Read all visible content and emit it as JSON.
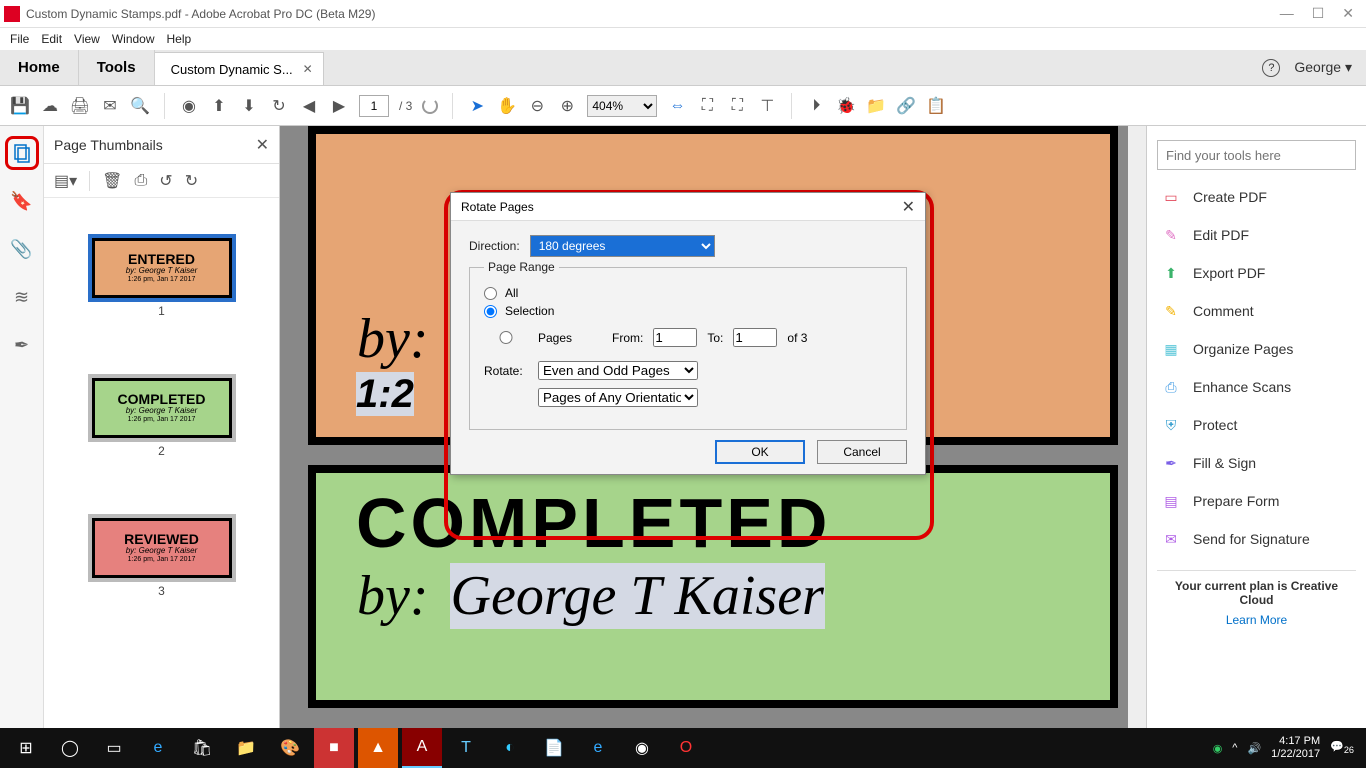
{
  "titlebar": {
    "title": "Custom Dynamic Stamps.pdf - Adobe Acrobat Pro DC (Beta M29)"
  },
  "menubar": {
    "items": [
      "File",
      "Edit",
      "View",
      "Window",
      "Help"
    ]
  },
  "tabs": {
    "home": "Home",
    "tools": "Tools",
    "doc": "Custom Dynamic S...",
    "user": "George"
  },
  "toolbar": {
    "page": "1",
    "pages_of": "/ 3",
    "zoom": "404%"
  },
  "thumbs": {
    "title": "Page Thumbnails",
    "items": [
      {
        "label": "ENTERED",
        "by": "by: George T Kaiser",
        "ts": "1:26 pm, Jan 17 2017",
        "bg": "#e6a574",
        "num": "1",
        "sel": true
      },
      {
        "label": "COMPLETED",
        "by": "by: George T Kaiser",
        "ts": "1:26 pm, Jan 17 2017",
        "bg": "#a6d48b",
        "num": "2",
        "sel": false
      },
      {
        "label": "REVIEWED",
        "by": "by: George T Kaiser",
        "ts": "1:26 pm, Jan 17 2017",
        "bg": "#e6817e",
        "num": "3",
        "sel": false
      }
    ]
  },
  "doc": {
    "page1": {
      "by": "by:",
      "ts_prefix": "1:2"
    },
    "page2": {
      "title": "COMPLETED",
      "by": "by:",
      "name": "George T Kaiser"
    }
  },
  "rightpanel": {
    "search_ph": "Find your tools here",
    "tools": [
      {
        "label": "Create PDF",
        "color": "#e2495b",
        "glyph": "▭"
      },
      {
        "label": "Edit PDF",
        "color": "#e071c4",
        "glyph": "✎"
      },
      {
        "label": "Export PDF",
        "color": "#3bb36b",
        "glyph": "⬆"
      },
      {
        "label": "Comment",
        "color": "#f2b200",
        "glyph": "✎"
      },
      {
        "label": "Organize Pages",
        "color": "#5bc7d9",
        "glyph": "▦"
      },
      {
        "label": "Enhance Scans",
        "color": "#4aa0e6",
        "glyph": "⎙"
      },
      {
        "label": "Protect",
        "color": "#3aa0d0",
        "glyph": "⛨"
      },
      {
        "label": "Fill & Sign",
        "color": "#7a5fe6",
        "glyph": "✒"
      },
      {
        "label": "Prepare Form",
        "color": "#b05fe6",
        "glyph": "▤"
      },
      {
        "label": "Send for Signature",
        "color": "#b05fe6",
        "glyph": "✉"
      }
    ],
    "plan": "Your current plan is Creative Cloud",
    "learn": "Learn More"
  },
  "dialog": {
    "title": "Rotate Pages",
    "direction_label": "Direction:",
    "direction_value": "180 degrees",
    "range_legend": "Page Range",
    "all": "All",
    "selection": "Selection",
    "pages": "Pages",
    "from": "From:",
    "to": "To:",
    "from_val": "1",
    "to_val": "1",
    "of": "of 3",
    "rotate_label": "Rotate:",
    "rotate_opt1": "Even and Odd Pages",
    "rotate_opt2": "Pages of Any Orientation",
    "ok": "OK",
    "cancel": "Cancel"
  },
  "taskbar": {
    "time": "4:17 PM",
    "date": "1/22/2017",
    "badge": "26"
  }
}
